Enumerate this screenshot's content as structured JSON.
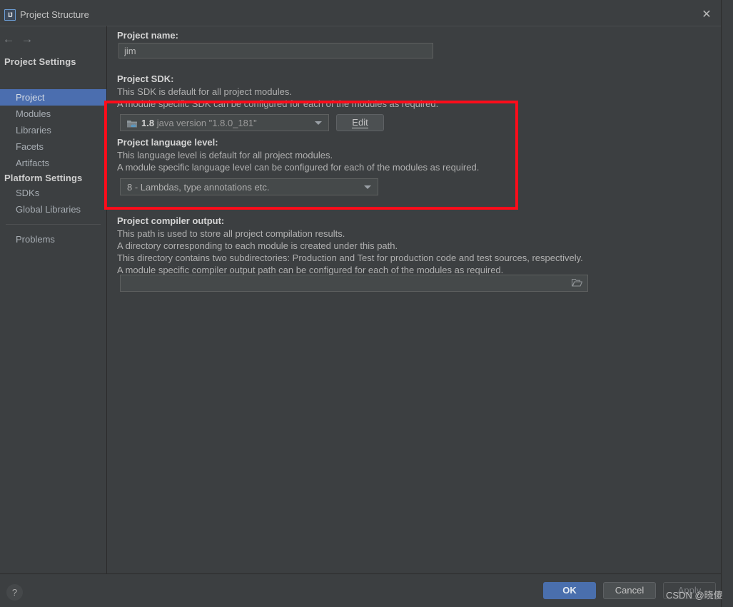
{
  "window": {
    "title": "Project Structure",
    "app_icon": "intellij-idea-icon",
    "close_icon": "close-icon"
  },
  "sidebar": {
    "nav": {
      "back_icon": "arrow-left-icon",
      "forward_icon": "arrow-right-icon"
    },
    "groups": [
      {
        "label": "Project Settings",
        "items": [
          {
            "label": "Project",
            "selected": true
          },
          {
            "label": "Modules",
            "selected": false
          },
          {
            "label": "Libraries",
            "selected": false
          },
          {
            "label": "Facets",
            "selected": false
          },
          {
            "label": "Artifacts",
            "selected": false
          }
        ]
      },
      {
        "label": "Platform Settings",
        "items": [
          {
            "label": "SDKs",
            "selected": false
          },
          {
            "label": "Global Libraries",
            "selected": false
          }
        ]
      }
    ],
    "extra_items": [
      {
        "label": "Problems",
        "selected": false
      }
    ]
  },
  "main": {
    "project_name": {
      "label": "Project name:",
      "value": "jim"
    },
    "project_sdk": {
      "label": "Project SDK:",
      "desc_line_1": "This SDK is default for all project modules.",
      "desc_line_2": "A module specific SDK can be configured for each of the modules as required.",
      "selected_version": "1.8",
      "selected_detail": "java version \"1.8.0_181\"",
      "sdk_icon": "java-folder-icon",
      "dropdown_icon": "chevron-down-icon",
      "edit_button": "Edit"
    },
    "project_language_level": {
      "label": "Project language level:",
      "desc_line_1": "This language level is default for all project modules.",
      "desc_line_2": "A module specific language level can be configured for each of the modules as required.",
      "selected": "8 - Lambdas, type annotations etc.",
      "dropdown_icon": "chevron-down-icon"
    },
    "project_compiler_output": {
      "label": "Project compiler output:",
      "desc_line_1": "This path is used to store all project compilation results.",
      "desc_line_2": "A directory corresponding to each module is created under this path.",
      "desc_line_3": "This directory contains two subdirectories: Production and Test for production code and test sources, respectively.",
      "desc_line_4": "A module specific compiler output path can be configured for each of the modules as required.",
      "value": "",
      "placeholder": "",
      "browse_icon": "folder-open-icon"
    }
  },
  "footer": {
    "help_icon": "?",
    "ok_label": "OK",
    "cancel_label": "Cancel",
    "apply_label": "Apply"
  },
  "overlay": {
    "annotation_box_color": "#fc0d1b",
    "watermark_text": "CSDN @晓傻"
  },
  "colors": {
    "dialog_bg": "#3c3f41",
    "sidebar_selected": "#4b6eaf",
    "ok_button": "#4a6fad",
    "annotation_red": "#fc0d1b"
  }
}
